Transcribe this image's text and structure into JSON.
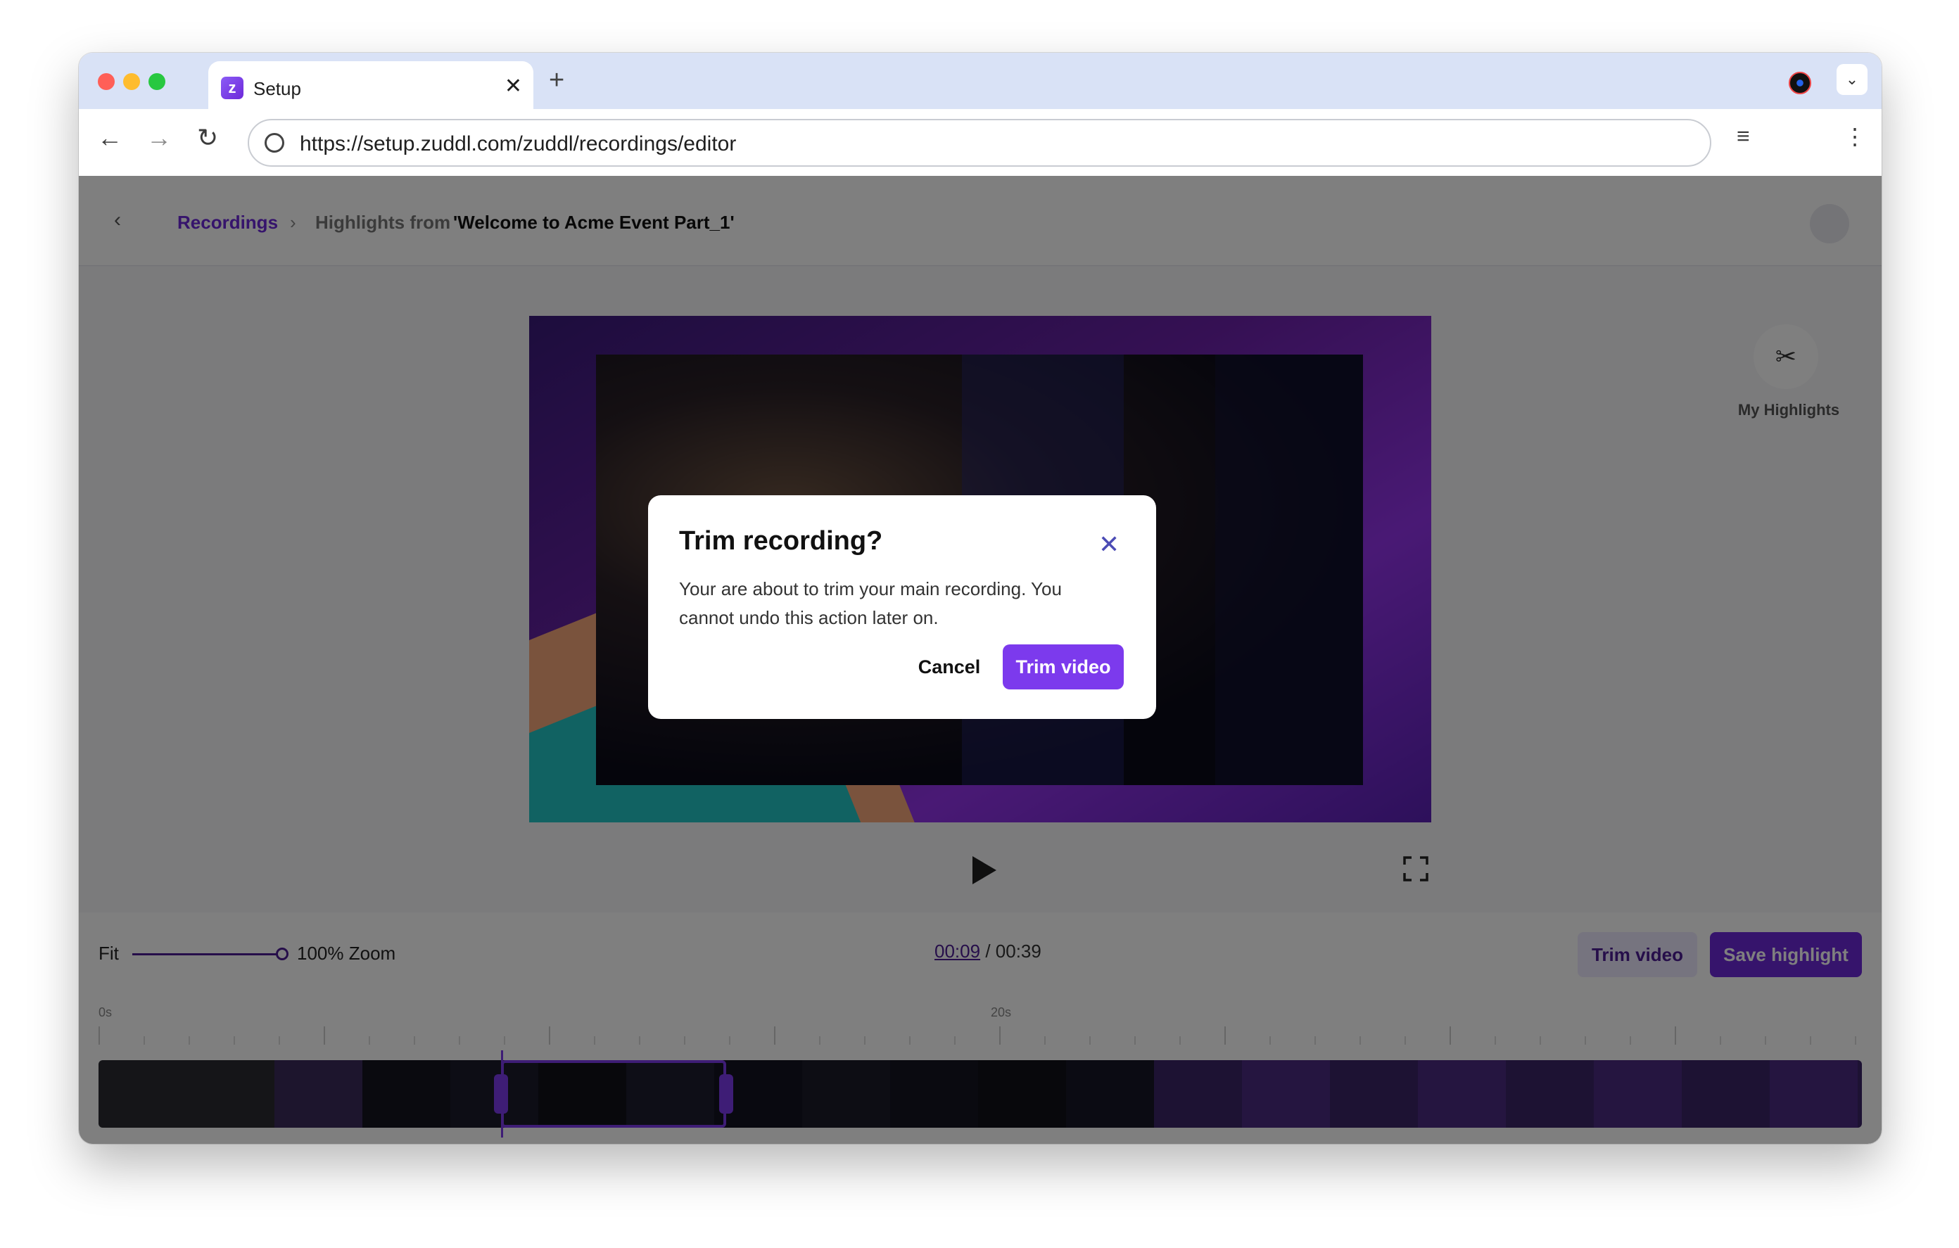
{
  "browser": {
    "tab_title": "Setup",
    "tab_favicon_letter": "z",
    "url": "https://setup.zuddl.com/zuddl/recordings/editor"
  },
  "breadcrumb": {
    "back": "‹",
    "recordings": "Recordings",
    "separator": "›",
    "highlights_prefix": "Highlights from",
    "recording_name": "'Welcome to Acme Event Part_1'"
  },
  "side_panel": {
    "my_highlights_label": "My Highlights",
    "icon": "scissors-icon"
  },
  "timeline": {
    "fit_label": "Fit",
    "zoom_label": "100% Zoom",
    "zoom_level": 1.0,
    "current_time": "00:09",
    "time_separator": "/",
    "total_time": "00:39",
    "trim_button": "Trim video",
    "save_button": "Save highlight",
    "ruler_labels": [
      "0s",
      "20s"
    ]
  },
  "modal": {
    "title": "Trim recording?",
    "body": "Your are about to trim your main recording. You cannot undo this action later on.",
    "cancel_label": "Cancel",
    "confirm_label": "Trim video"
  },
  "colors": {
    "accent": "#7c3aed",
    "accent_dark": "#4c1d95",
    "overlay": "rgba(0,0,0,0.5)"
  }
}
